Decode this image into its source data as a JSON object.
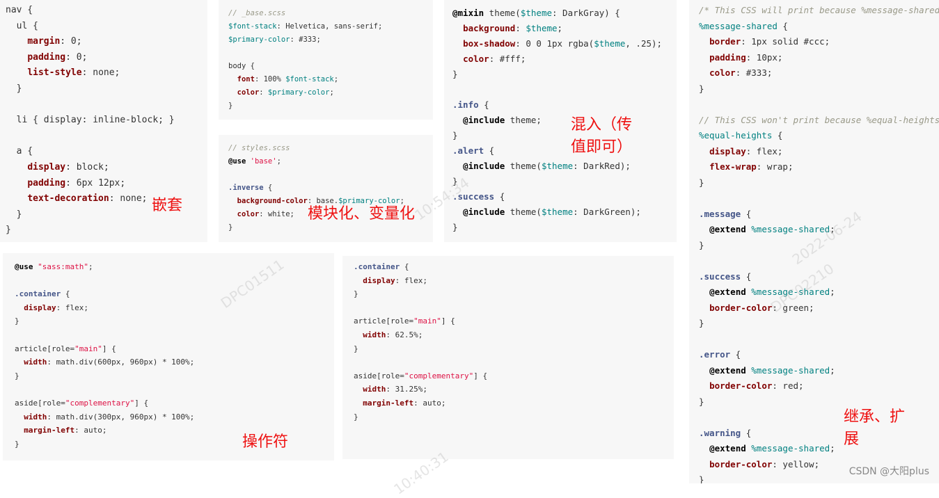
{
  "panels": {
    "nesting": {
      "code": "nav {\n  ul {\n    margin: 0;\n    padding: 0;\n    list-style: none;\n  }\n\n  li { display: inline-block; }\n\n  a {\n    display: block;\n    padding: 6px 12px;\n    text-decoration: none;\n  }\n}",
      "annotation": "嵌套"
    },
    "modules": {
      "base_code": "// _base.scss\n$font-stack: Helvetica, sans-serif;\n$primary-color: #333;\n\nbody {\n  font: 100% $font-stack;\n  color: $primary-color;\n}",
      "styles_code": "// styles.scss\n@use 'base';\n\n.inverse {\n  background-color: base.$primary-color;\n  color: white;\n}",
      "annotation": "模块化、变量化"
    },
    "mixins": {
      "code": "@mixin theme($theme: DarkGray) {\n  background: $theme;\n  box-shadow: 0 0 1px rgba($theme, .25);\n  color: #fff;\n}\n\n.info {\n  @include theme;\n}\n.alert {\n  @include theme($theme: DarkRed);\n}\n.success {\n  @include theme($theme: DarkGreen);\n}",
      "annotation": "混入（传\n值即可）"
    },
    "extend": {
      "code": "/* This CSS will print because %message-shared\n%message-shared {\n  border: 1px solid #ccc;\n  padding: 10px;\n  color: #333;\n}\n\n// This CSS won't print because %equal-heights\n%equal-heights {\n  display: flex;\n  flex-wrap: wrap;\n}\n\n.message {\n  @extend %message-shared;\n}\n\n.success {\n  @extend %message-shared;\n  border-color: green;\n}\n\n.error {\n  @extend %message-shared;\n  border-color: red;\n}\n\n.warning {\n  @extend %message-shared;\n  border-color: yellow;\n}",
      "annotation": "继承、扩\n展"
    },
    "operators_scss": {
      "code": "@use \"sass:math\";\n\n.container {\n  display: flex;\n}\n\narticle[role=\"main\"] {\n  width: math.div(600px, 960px) * 100%;\n}\n\naside[role=\"complementary\"] {\n  width: math.div(300px, 960px) * 100%;\n  margin-left: auto;\n}",
      "annotation": "操作符"
    },
    "operators_css": {
      "code": ".container {\n  display: flex;\n}\n\narticle[role=\"main\"] {\n  width: 62.5%;\n}\n\naside[role=\"complementary\"] {\n  width: 31.25%;\n  margin-left: auto;\n}"
    }
  },
  "watermarks": [
    "DPC01511",
    "DPC02210",
    "2022-06-24",
    "10:54:34",
    "10:40:31"
  ],
  "credit": "CSDN @大阳plus",
  "colors": {
    "panel_bg": "#f7f7f7",
    "annotation": "#ee1111",
    "property": "#800000",
    "variable": "#008080",
    "string": "#dd1144",
    "comment": "#999988"
  }
}
